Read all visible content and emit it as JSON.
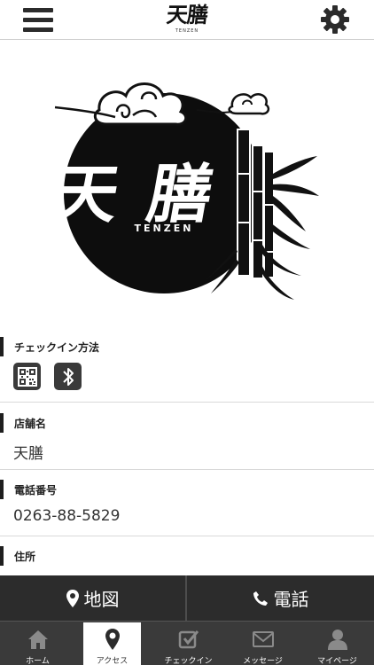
{
  "header": {
    "logo_kanji": "天膳",
    "logo_sub": "TENZEN",
    "menu_icon": "hamburger-menu-icon",
    "settings_icon": "gear-icon"
  },
  "hero": {
    "logo_kanji_left": "天",
    "logo_kanji_right": "膳",
    "logo_sub": "TENZEN"
  },
  "sections": {
    "checkin": {
      "label": "チェックイン方法",
      "icons": [
        "qr-code-icon",
        "bluetooth-icon"
      ]
    },
    "store": {
      "label": "店舗名",
      "value": "天膳"
    },
    "phone": {
      "label": "電話番号",
      "value": "0263-88-5829"
    },
    "address": {
      "label": "住所"
    }
  },
  "actions": {
    "map_label": "地図",
    "tel_label": "電話"
  },
  "tabs": [
    {
      "label": "ホーム",
      "icon": "home-icon"
    },
    {
      "label": "アクセス",
      "icon": "map-pin-icon",
      "active": true
    },
    {
      "label": "チェックイン",
      "icon": "checkin-icon"
    },
    {
      "label": "メッセージ",
      "icon": "mail-icon"
    },
    {
      "label": "マイページ",
      "icon": "user-icon"
    }
  ],
  "colors": {
    "dark": "#2c2c2c",
    "tab_bar": "#3a3a3a",
    "accent_bar": "#1e1e1e"
  }
}
